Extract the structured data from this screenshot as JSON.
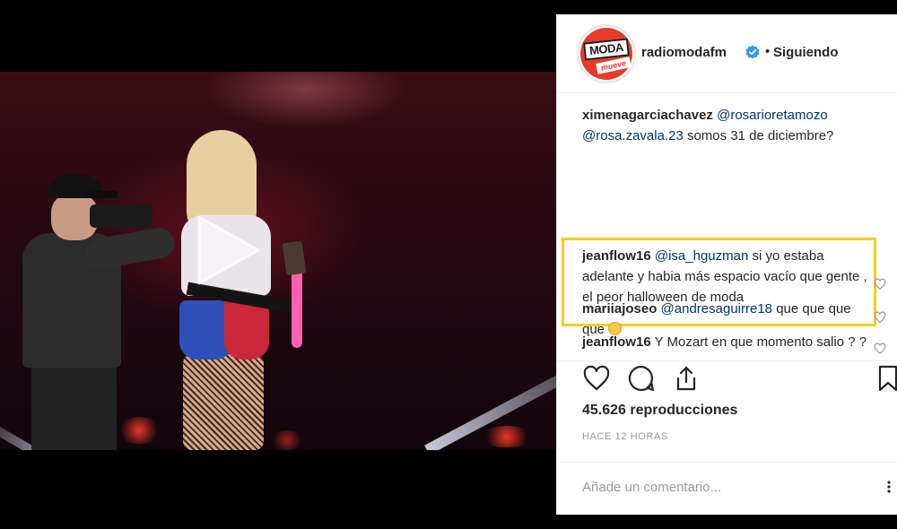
{
  "post": {
    "username": "radiomodafm",
    "follow_status": "Siguiendo",
    "separator": "•",
    "avatar": {
      "logo_text": "MODA",
      "tag_text": "mueve"
    },
    "views": "45.626 reproducciones",
    "time_ago": "HACE 12 HORAS",
    "add_comment_placeholder": "Añade un comentario..."
  },
  "comments": [
    {
      "user": "ximenagarciachavez",
      "mentions": [
        "@rosarioretamozo",
        "@rosa.zavala.23"
      ],
      "text": "somos 31 de diciembre?"
    },
    {
      "user": "jeanflow16",
      "mentions": [
        "@isa_hguzman"
      ],
      "text": "si yo estaba adelante y habia más espacio vacío que gente , el peor halloween de moda",
      "highlighted": true
    },
    {
      "user": "jeanflow16",
      "mentions": [],
      "text": "Y Mozart en que momento salio ? ?"
    },
    {
      "user": "mariiajoseo",
      "mentions": [
        "@andresaguirre18"
      ],
      "text": "que que que que"
    }
  ],
  "icons": {
    "play": "play-icon",
    "verified": "verified-badge-icon",
    "like": "heart-icon",
    "comment": "comment-icon",
    "share": "share-icon",
    "save": "bookmark-icon",
    "comment_like": "heart-small-icon"
  },
  "colors": {
    "highlight_border": "#f5cd25",
    "mention": "#003569",
    "verified": "#3897f0",
    "brand_red": "#e8392b"
  }
}
